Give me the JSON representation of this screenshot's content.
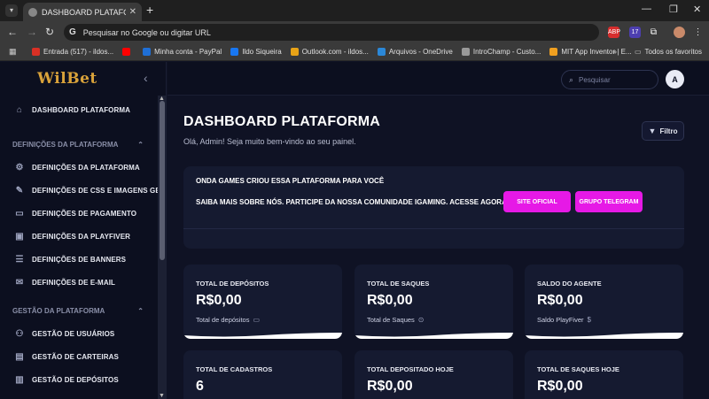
{
  "browser": {
    "tab_title": "DASHBOARD PLATAFORMA - W",
    "address_placeholder": "Pesquisar no Google ou digitar URL",
    "bookmarks": [
      {
        "label": "Entrada (517) - ildos...",
        "color": "#d93025"
      },
      {
        "label": "",
        "color": "#ff0000"
      },
      {
        "label": "Minha conta - PayPal",
        "color": "#1f6fd6"
      },
      {
        "label": "Ildo Siqueira",
        "color": "#1877f2"
      },
      {
        "label": "Outlook.com - ildos...",
        "color": "#e8a317"
      },
      {
        "label": "Arquivos - OneDrive",
        "color": "#2b88d8"
      },
      {
        "label": "IntroChamp - Custo...",
        "color": "#999999"
      },
      {
        "label": "MIT App Inventor | E...",
        "color": "#f0a020"
      }
    ],
    "bookmarks_more": "»",
    "bookmarks_all": "Todos os favoritos",
    "ext_badge": "17"
  },
  "sidebar": {
    "logo": "WilBet",
    "items": [
      {
        "label": "DASHBOARD PLATAFORMA",
        "icon": "⌂"
      },
      {
        "section": "DEFINIÇÕES DA PLATAFORMA"
      },
      {
        "label": "DEFINIÇÕES DA PLATAFORMA",
        "icon": "⚙"
      },
      {
        "label": "DEFINIÇÕES DE CSS E IMAGENS GER...",
        "icon": "✎"
      },
      {
        "label": "DEFINIÇÕES DE PAGAMENTO",
        "icon": "▭"
      },
      {
        "label": "DEFINIÇÕES DA PLAYFIVER",
        "icon": "▣"
      },
      {
        "label": "DEFINIÇÕES DE BANNERS",
        "icon": "☰"
      },
      {
        "label": "DEFINIÇÕES DE E-MAIL",
        "icon": "✉"
      },
      {
        "section": "GESTÃO DA PLATAFORMA"
      },
      {
        "label": "GESTÃO DE USUÁRIOS",
        "icon": "⚇"
      },
      {
        "label": "GESTÃO DE CARTEIRAS",
        "icon": "▤"
      },
      {
        "label": "GESTÃO DE DEPÓSITOS",
        "icon": "▥"
      }
    ]
  },
  "topbar": {
    "search_placeholder": "Pesquisar",
    "avatar_initial": "A"
  },
  "main": {
    "title": "DASHBOARD PLATAFORMA",
    "subtitle": "Olá, Admin! Seja muito bem-vindo ao seu painel.",
    "filter_label": "Filtro",
    "promo": {
      "line1": "ONDA GAMES CRIOU ESSA PLATAFORMA PARA VOCÊ",
      "line2": "SAIBA MAIS SOBRE NÓS. PARTICIPE DA NOSSA COMUNIDADE IGAMING. ACESSE AGORA!",
      "btn_site": "SITE OFICIAL",
      "btn_telegram": "GRUPO TELEGRAM"
    },
    "cards": [
      {
        "title": "TOTAL DE DEPÓSITOS",
        "value": "R$0,00",
        "sub": "Total de depósitos",
        "icon": "▭"
      },
      {
        "title": "TOTAL DE SAQUES",
        "value": "R$0,00",
        "sub": "Total de Saques",
        "icon": "⊙"
      },
      {
        "title": "SALDO DO AGENTE",
        "value": "R$0,00",
        "sub": "Saldo PlayFiver",
        "icon": "$"
      },
      {
        "title": "TOTAL DE CADASTROS",
        "value": "6",
        "sub": "",
        "icon": ""
      },
      {
        "title": "TOTAL DEPOSITADO HOJE",
        "value": "R$0,00",
        "sub": "",
        "icon": ""
      },
      {
        "title": "TOTAL DE SAQUES HOJE",
        "value": "R$0,00",
        "sub": "",
        "icon": ""
      }
    ]
  },
  "colors": {
    "accent": "#e619e6",
    "logo": "#d9a23a",
    "background": "#0f1224",
    "card": "#151a30"
  }
}
